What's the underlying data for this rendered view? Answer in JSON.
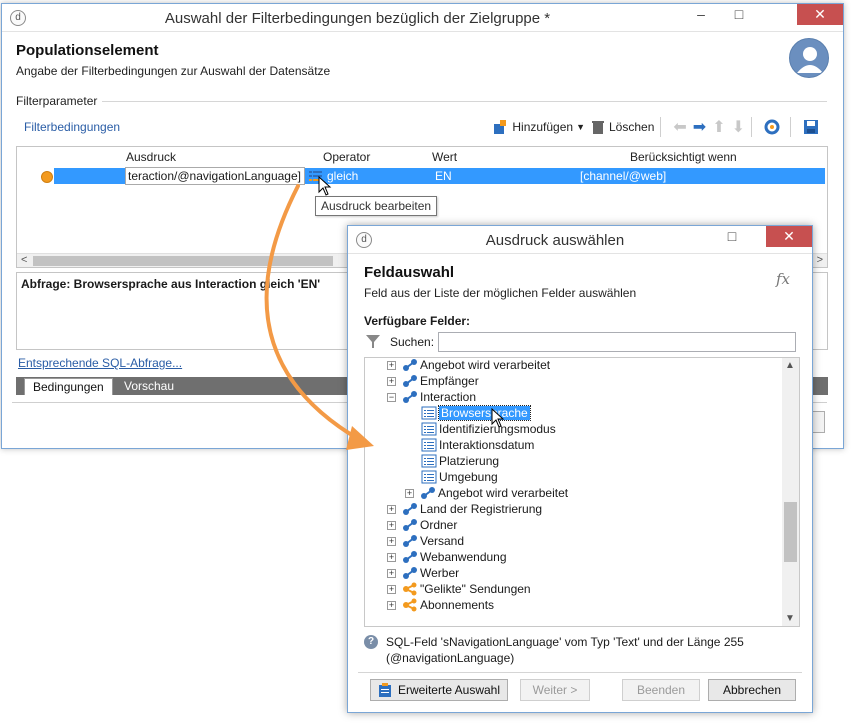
{
  "main_window": {
    "title": "Auswahl der Filterbedingungen bezüglich der Zielgruppe *",
    "header_title": "Populationselement",
    "header_subtitle": "Angabe der Filterbedingungen zur Auswahl der Datensätze",
    "section_label": "Filterparameter",
    "filter_link": "Filterbedingungen",
    "toolbar": {
      "add": "Hinzufügen",
      "delete": "Löschen"
    },
    "grid": {
      "columns": [
        "Ausdruck",
        "Operator",
        "Wert",
        "Berücksichtigt wenn"
      ],
      "row": {
        "expression": "teraction/@navigationLanguage]",
        "operator": "gleich",
        "value": "EN",
        "condition": "[channel/@web]"
      }
    },
    "tooltip": "Ausdruck bearbeiten",
    "query_text": "Abfrage: Browsersprache aus Interaction gleich 'EN'",
    "sql_link": "Entsprechende SQL-Abfrage...",
    "tabs": [
      "Bedingungen",
      "Vorschau"
    ]
  },
  "dialog": {
    "title": "Ausdruck auswählen",
    "header_title": "Feldauswahl",
    "header_subtitle": "Feld aus der Liste der möglichen Felder auswählen",
    "fx": "fx",
    "available_label": "Verfügbare Felder:",
    "search_label": "Suchen:",
    "search_value": "",
    "tree": [
      {
        "label": "Angebot wird verarbeitet",
        "expander": "+"
      },
      {
        "label": "Empfänger",
        "expander": "+"
      },
      {
        "label": "Interaction",
        "expander": "−"
      },
      {
        "label": "Browsersprache",
        "expander": ""
      },
      {
        "label": "Identifizierungsmodus",
        "expander": ""
      },
      {
        "label": "Interaktionsdatum",
        "expander": ""
      },
      {
        "label": "Platzierung",
        "expander": ""
      },
      {
        "label": "Umgebung",
        "expander": ""
      },
      {
        "label": "Angebot wird verarbeitet",
        "expander": "+"
      },
      {
        "label": "Land der Registrierung",
        "expander": "+"
      },
      {
        "label": "Ordner",
        "expander": "+"
      },
      {
        "label": "Versand",
        "expander": "+"
      },
      {
        "label": "Webanwendung",
        "expander": "+"
      },
      {
        "label": "Werber",
        "expander": "+"
      },
      {
        "label": "\"Gelikte\" Sendungen",
        "expander": "+"
      },
      {
        "label": "Abonnements",
        "expander": "+"
      }
    ],
    "info_line1": "SQL-Feld 'sNavigationLanguage' vom Typ 'Text' und der Länge 255",
    "info_line2": "(@navigationLanguage)",
    "buttons": {
      "advanced": "Erweiterte Auswahl",
      "next": "Weiter >",
      "finish": "Beenden",
      "cancel": "Abbrechen"
    }
  },
  "colors": {
    "selection": "#3399ff",
    "link": "#2a5da6",
    "arrow": "#f39a46",
    "close": "#c75050"
  }
}
